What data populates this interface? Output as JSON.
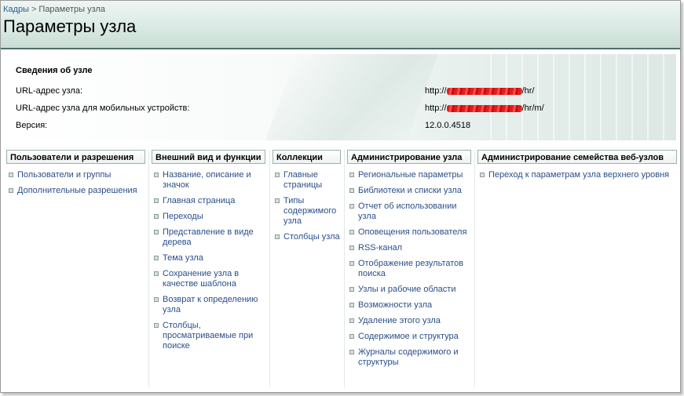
{
  "breadcrumb": {
    "parent": "Кадры",
    "separator": ">",
    "current": "Параметры узла"
  },
  "page": {
    "title": "Параметры узла"
  },
  "info": {
    "heading": "Сведения об узле",
    "url_label": "URL-адрес узла:",
    "url_prefix": "http://",
    "url_suffix": "/hr/",
    "mobile_label": "URL-адрес узла для мобильных устройств:",
    "mobile_prefix": "http://",
    "mobile_suffix": "/hr/m/",
    "version_label": "Версия:",
    "version_value": "12.0.0.4518"
  },
  "columns": [
    {
      "title": "Пользователи и разрешения",
      "items": [
        "Пользователи и группы",
        "Дополнительные разрешения"
      ]
    },
    {
      "title": "Внешний вид и функции",
      "items": [
        "Название, описание и значок",
        "Главная страница",
        "Переходы",
        "Представление в виде дерева",
        "Тема узла",
        "Сохранение узла в качестве шаблона",
        "Возврат к определению узла",
        "Столбцы, просматриваемые при поиске"
      ]
    },
    {
      "title": "Коллекции",
      "items": [
        "Главные страницы",
        "Типы содержимого узла",
        "Столбцы узла"
      ]
    },
    {
      "title": "Администрирование узла",
      "items": [
        "Региональные параметры",
        "Библиотеки и списки узла",
        "Отчет об использовании узла",
        "Оповещения пользователя",
        "RSS-канал",
        "Отображение результатов поиска",
        "Узлы и рабочие области",
        "Возможности узла",
        "Удаление этого узла",
        "Содержимое и структура",
        "Журналы содержимого и структуры"
      ]
    },
    {
      "title": "Администрирование семейства веб-узлов",
      "items": [
        "Переход к параметрам узла верхнего уровня"
      ]
    }
  ]
}
